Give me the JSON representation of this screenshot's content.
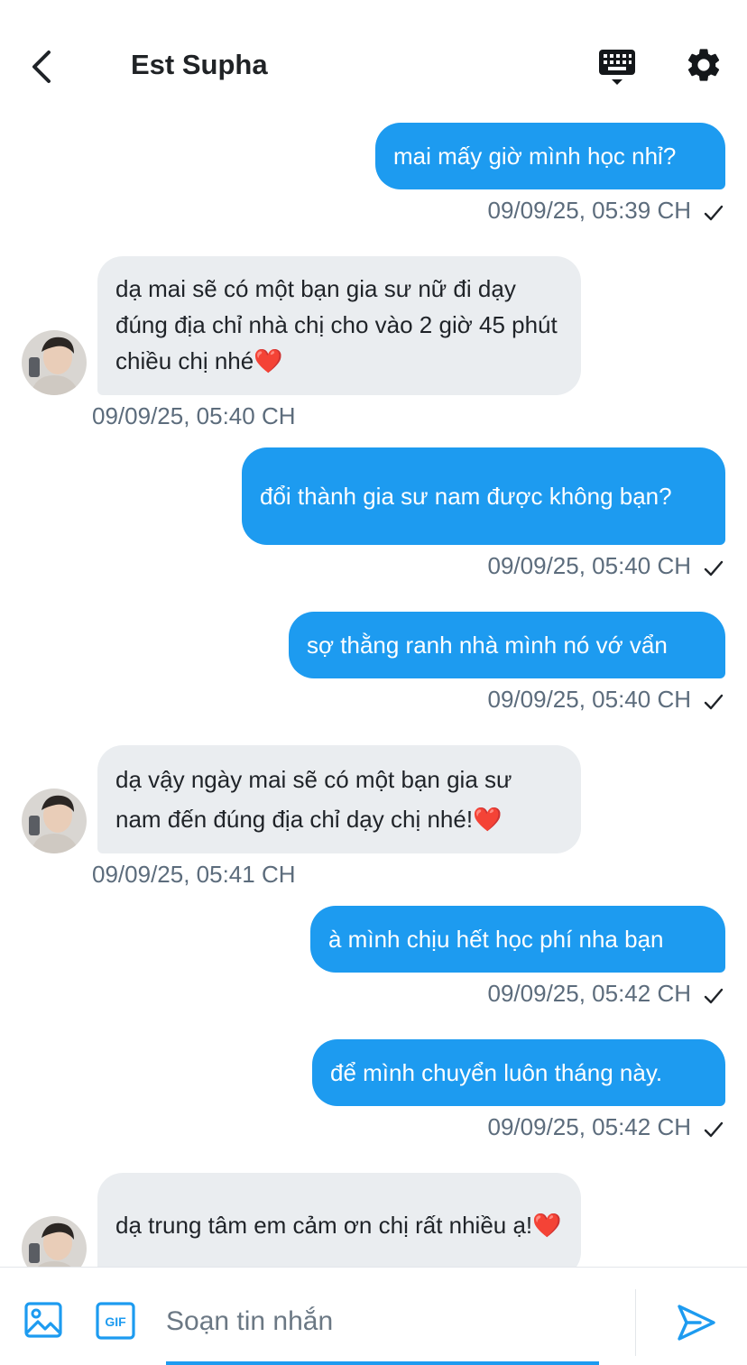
{
  "header": {
    "title": "Est Supha"
  },
  "messages": [
    {
      "dir": "sent",
      "text": "mai mấy giờ mình học nhỉ?",
      "time": "09/09/25, 05:39 CH"
    },
    {
      "dir": "recv",
      "text": "dạ mai sẽ có một bạn gia sư nữ đi dạy đúng địa chỉ nhà chị cho vào 2 giờ 45 phút chiều chị nhé❤️",
      "time": "09/09/25, 05:40 CH"
    },
    {
      "dir": "sent",
      "text": "đổi thành gia sư nam được không bạn?",
      "time": "09/09/25, 05:40 CH"
    },
    {
      "dir": "sent",
      "text": "sợ thằng ranh nhà mình nó vớ vẩn",
      "time": "09/09/25, 05:40 CH"
    },
    {
      "dir": "recv",
      "text": "dạ vậy ngày mai sẽ có một bạn gia sư nam đến đúng địa chỉ dạy chị nhé!❤️",
      "time": "09/09/25, 05:41 CH"
    },
    {
      "dir": "sent",
      "text": "à mình chịu hết học phí nha bạn",
      "time": "09/09/25, 05:42 CH"
    },
    {
      "dir": "sent",
      "text": "để mình chuyển luôn tháng này.",
      "time": "09/09/25, 05:42 CH"
    },
    {
      "dir": "recv",
      "text": "dạ trung tâm em cảm ơn chị rất nhiều ạ!❤️",
      "time": ""
    }
  ],
  "composer": {
    "placeholder": "Soạn tin nhắn",
    "gif_label": "GIF"
  },
  "colors": {
    "accent": "#1d9bf0",
    "received_bubble": "#eaedf0",
    "timestamp": "#5c6c7c"
  },
  "icons": {
    "back": "chevron-left-icon",
    "keyboard": "keyboard-icon",
    "settings": "gear-icon",
    "image": "image-icon",
    "gif": "gif-icon",
    "send": "send-icon"
  }
}
